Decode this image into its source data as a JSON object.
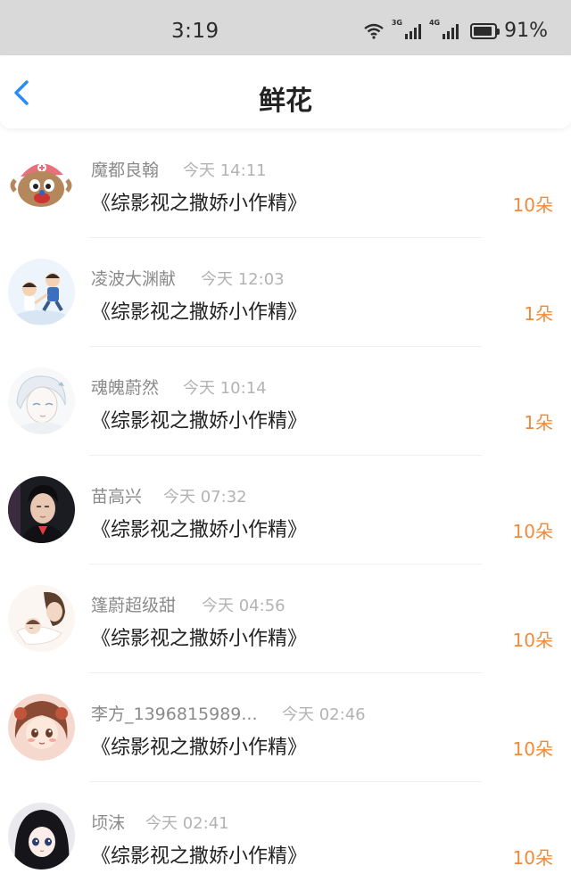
{
  "status_bar": {
    "time": "3:19",
    "network_1": "3G",
    "network_2": "4G",
    "battery_percent": "91%",
    "battery_level": 0.91
  },
  "header": {
    "title": "鲜花",
    "back_icon": "chevron-left-icon",
    "accent_color": "#2a8cf5"
  },
  "count_color": "#f08a3a",
  "records": [
    {
      "user": "魔都良翰",
      "time": "今天 14:11",
      "book": "《综影视之撒娇小作精》",
      "count": "10朵",
      "avatar": "cartoon-reindeer"
    },
    {
      "user": "凌波大渊献",
      "time": "今天 12:03",
      "book": "《综影视之撒娇小作精》",
      "count": "1朵",
      "avatar": "two-kids-cartoon"
    },
    {
      "user": "魂魄蔚然",
      "time": "今天 10:14",
      "book": "《综影视之撒娇小作精》",
      "count": "1朵",
      "avatar": "anime-boy-sketch"
    },
    {
      "user": "苗高兴",
      "time": "今天 07:32",
      "book": "《综影视之撒娇小作精》",
      "count": "10朵",
      "avatar": "man-portrait-dark"
    },
    {
      "user": "篷蔚超级甜",
      "time": "今天 04:56",
      "book": "《综影视之撒娇小作精》",
      "count": "10朵",
      "avatar": "mother-child-illustration"
    },
    {
      "user": "李方_1396815989...",
      "time": "今天 02:46",
      "book": "《综影视之撒娇小作精》",
      "count": "10朵",
      "avatar": "anime-girl-brown-hair"
    },
    {
      "user": "顷沫",
      "time": "今天 02:41",
      "book": "《综影视之撒娇小作精》",
      "count": "10朵",
      "avatar": "anime-girl-black-hair"
    }
  ]
}
